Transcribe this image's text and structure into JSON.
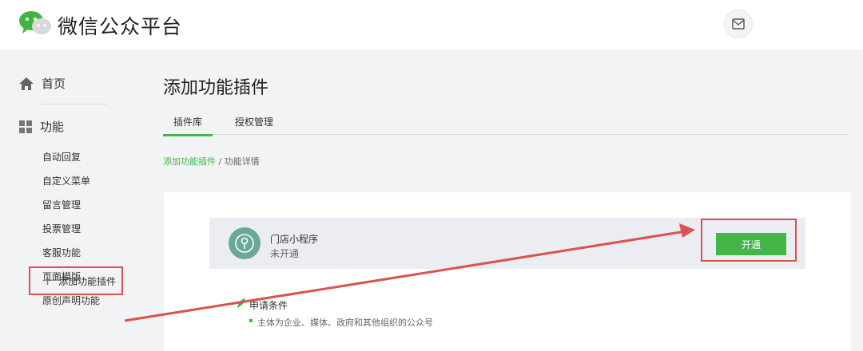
{
  "header": {
    "brand": "微信公众平台",
    "logo_icon": "wechat-logo-icon",
    "mail_icon": "mail-icon"
  },
  "sidebar": {
    "home_label": "首页",
    "home_icon": "home-icon",
    "group_label": "功能",
    "group_icon": "grid-icon",
    "items": [
      {
        "label": "自动回复"
      },
      {
        "label": "自定义菜单"
      },
      {
        "label": "留言管理"
      },
      {
        "label": "投票管理"
      },
      {
        "label": "客服功能"
      },
      {
        "label": "页面模版"
      },
      {
        "label": "原创声明功能"
      }
    ],
    "add_plugin_label": "添加功能插件",
    "add_plugin_icon": "plus-icon"
  },
  "main": {
    "title": "添加功能插件",
    "tabs": [
      {
        "label": "插件库"
      },
      {
        "label": "授权管理"
      }
    ],
    "breadcrumb": {
      "link": "添加功能插件",
      "separator": "/",
      "current": "功能详情"
    },
    "plugin": {
      "name": "门店小程序",
      "status": "未开通",
      "icon": "store-miniprogram-icon",
      "open_button": "开通"
    },
    "conditions": {
      "title": "申请条件",
      "items": [
        "主体为企业、媒体、政府和其他组织的公众号"
      ]
    }
  },
  "colors": {
    "accent_green": "#44b549",
    "highlight_red": "#d9534f",
    "plugin_icon_bg": "#6aa99a"
  }
}
